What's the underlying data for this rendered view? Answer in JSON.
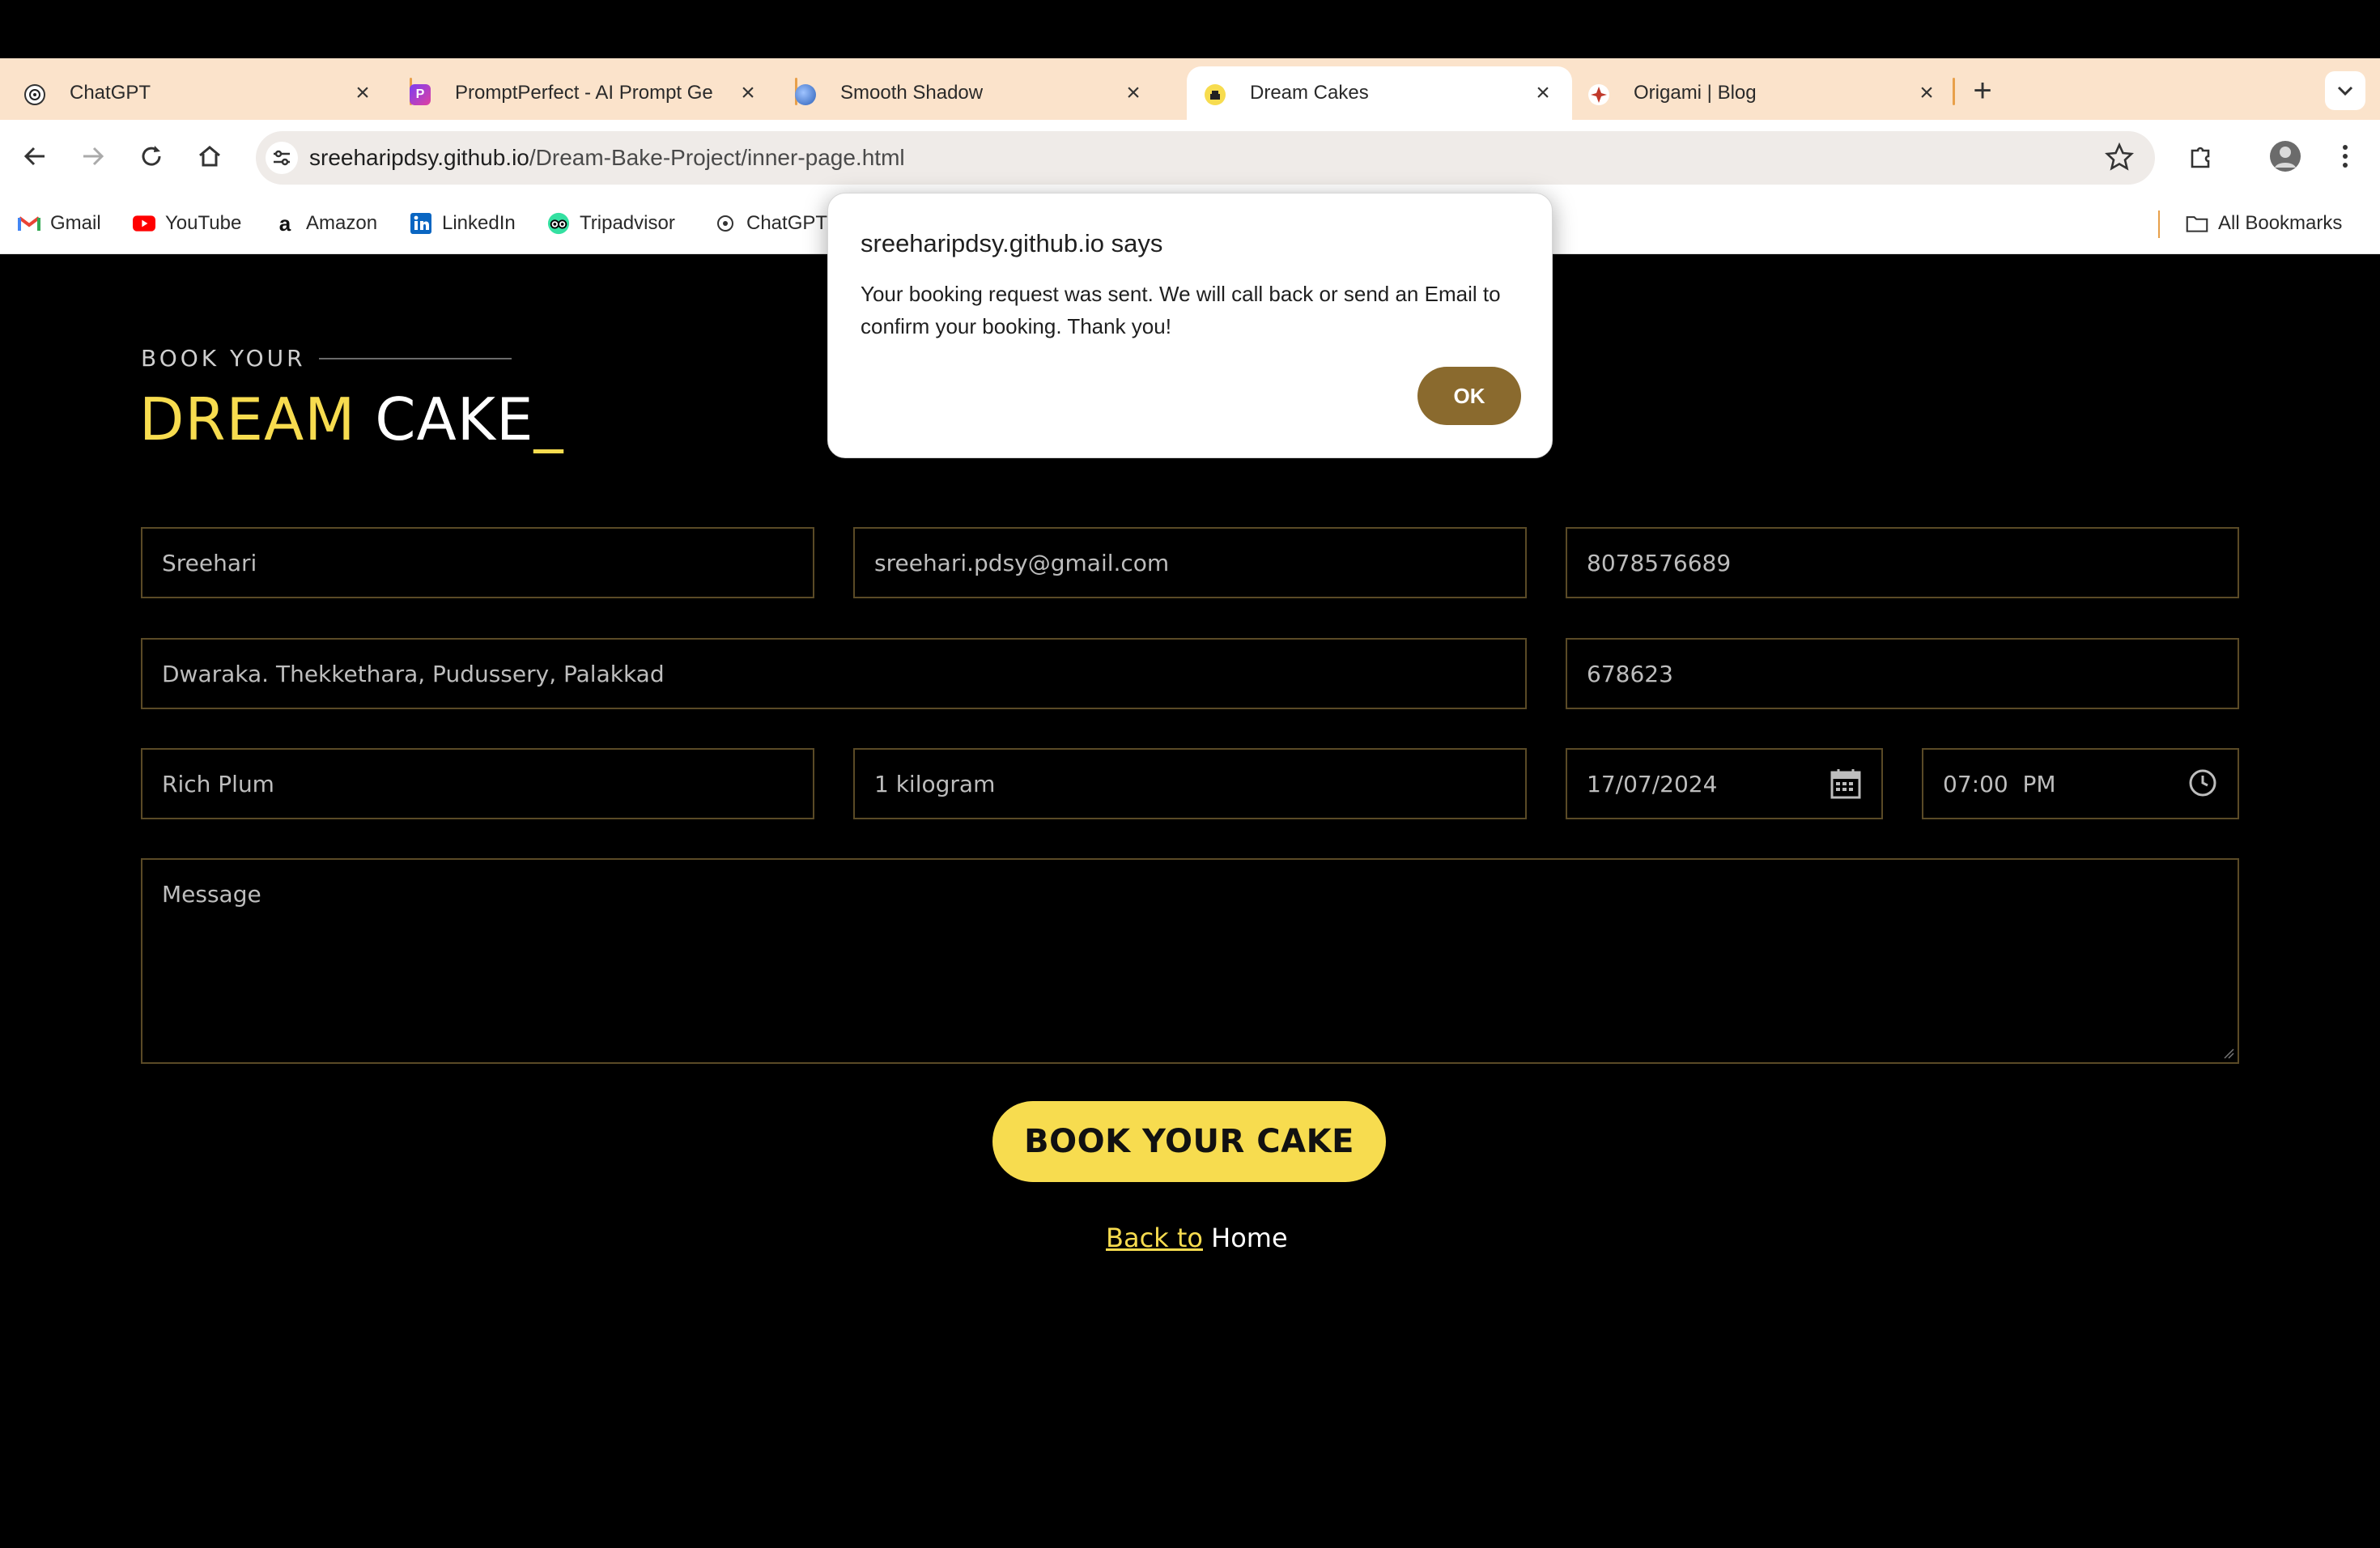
{
  "browser": {
    "tabs": [
      {
        "title": "ChatGPT",
        "active": false
      },
      {
        "title": "PromptPerfect - AI Prompt Ge",
        "active": false
      },
      {
        "title": "Smooth Shadow",
        "active": false
      },
      {
        "title": "Dream Cakes",
        "active": true
      },
      {
        "title": "Origami | Blog",
        "active": false
      }
    ],
    "url_host": "sreeharipdsy.github.io",
    "url_path": "/Dream-Bake-Project/inner-page.html",
    "bookmarks": [
      "Gmail",
      "YouTube",
      "Amazon",
      "LinkedIn",
      "Tripadvisor",
      "ChatGPT"
    ],
    "all_bookmarks_label": "All Bookmarks"
  },
  "page": {
    "eyebrow": "BOOK YOUR",
    "headline_highlight": "DREAM",
    "headline_rest": " CAKE",
    "headline_cursor": "_",
    "form": {
      "name": "Sreehari",
      "email": "sreehari.pdsy@gmail.com",
      "phone": "8078576689",
      "address": "Dwaraka. Thekkethara, Pudussery, Palakkad",
      "pincode": "678623",
      "flavour": "Rich Plum",
      "weight": "1 kilogram",
      "date": "17/07/2024",
      "time": "07:00  PM",
      "message_placeholder": "Message"
    },
    "submit_label": "BOOK YOUR CAKE",
    "back_link": "Back to",
    "back_rest": " Home"
  },
  "dialog": {
    "title": "sreeharipdsy.github.io says",
    "message": "Your booking request was sent. We will call back or send an Email to confirm your booking. Thank you!",
    "ok_label": "OK"
  },
  "colors": {
    "accent_yellow": "#f7dc4f",
    "field_border": "#5a4a26",
    "ok_button": "#8a6a2e",
    "tabstrip": "#fbe3cb"
  }
}
